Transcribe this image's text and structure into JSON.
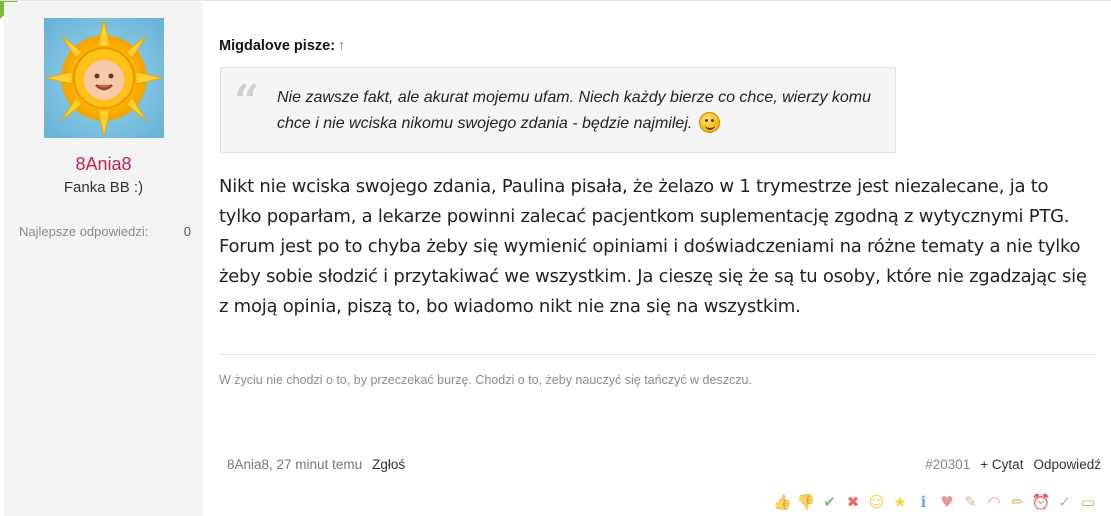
{
  "user": {
    "name": "8Ania8",
    "title": "Fanka BB :)",
    "stat_label": "Najlepsze odpowiedzi:",
    "stat_value": "0",
    "avatar": "sun-baby-avatar"
  },
  "quote": {
    "author": "Migdalove pisze:",
    "arrow": "↑",
    "text": "Nie zawsze fakt, ale akurat mojemu ufam. Niech każdy bierze co chce, wierzy komu chce i nie wciska nikomu swojego zdania - będzie najmilej."
  },
  "message": "Nikt nie wciska swojego zdania, Paulina pisała, że żelazo w 1 trymestrze jest niezalecane, ja to tylko poparłam, a lekarze powinni zalecać pacjentkom suplementację zgodną z wytycznymi PTG. Forum jest po to chyba żeby się wymienić opiniami i doświadczeniami na różne tematy a nie tylko żeby sobie słodzić i przytakiwać we wszystkim. Ja cieszę się że są tu osoby, które nie zgadzając się z moją opinia, piszą to, bo wiadomo nikt nie zna się na wszystkim.",
  "signature": "W życiu nie chodzi o to, by przeczekać burzę. Chodzi o to, żeby nauczyć się tańczyć w deszczu.",
  "footer": {
    "meta": "8Ania8, 27 minut temu",
    "report": "Zgłoś",
    "post_number": "#20301",
    "quote_label": "+ Cytat",
    "reply_label": "Odpowiedź"
  },
  "reactions": [
    {
      "name": "thumbs-up-icon",
      "glyph": "👍",
      "color": "#d9a066"
    },
    {
      "name": "thumbs-down-icon",
      "glyph": "👎",
      "color": "#d9a066"
    },
    {
      "name": "check-icon",
      "glyph": "✔",
      "color": "#4caf50"
    },
    {
      "name": "cross-icon",
      "glyph": "✖",
      "color": "#e53935"
    },
    {
      "name": "smile-icon",
      "glyph": "☺",
      "color": "#f5b400"
    },
    {
      "name": "star-icon",
      "glyph": "★",
      "color": "#f2c200"
    },
    {
      "name": "info-icon",
      "glyph": "ℹ",
      "color": "#3f8ad6"
    },
    {
      "name": "heart-icon",
      "glyph": "♥",
      "color": "#e57373"
    },
    {
      "name": "bone-icon",
      "glyph": "✎",
      "color": "#c9a27a"
    },
    {
      "name": "rainbow-icon",
      "glyph": "◠",
      "color": "#e86aa0"
    },
    {
      "name": "pencil-icon",
      "glyph": "✏",
      "color": "#d4a24a"
    },
    {
      "name": "alarm-icon",
      "glyph": "⏰",
      "color": "#e05a5a"
    },
    {
      "name": "abc-icon",
      "glyph": "✓",
      "color": "#6aa0d8"
    },
    {
      "name": "box-icon",
      "glyph": "▭",
      "color": "#b8895a"
    }
  ]
}
